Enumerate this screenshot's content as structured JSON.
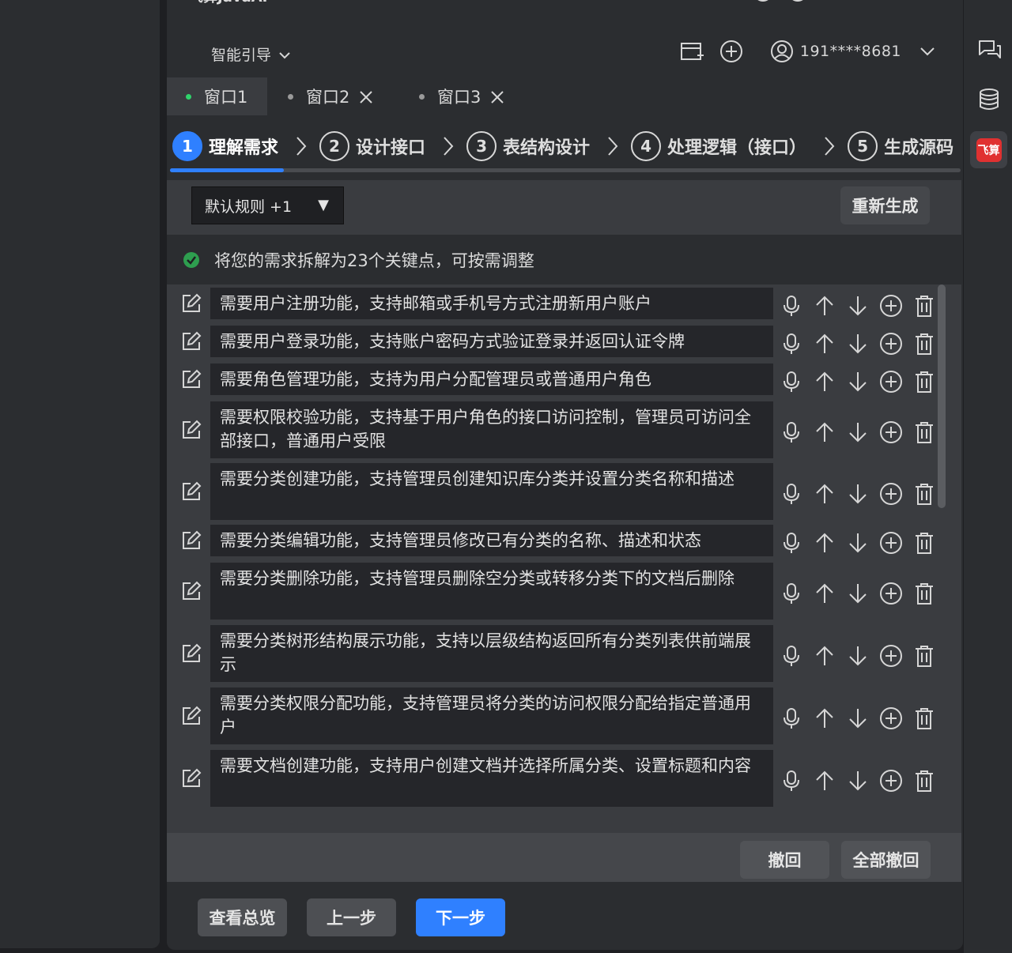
{
  "app": {
    "title": "飞算JavaAI",
    "smart_guide_label": "智能引导",
    "user_phone": "191****8681"
  },
  "tabs": [
    {
      "label": "窗口1",
      "active": true
    },
    {
      "label": "窗口2",
      "active": false
    },
    {
      "label": "窗口3",
      "active": false
    }
  ],
  "steps": [
    {
      "num": "1",
      "label": "理解需求",
      "active": true
    },
    {
      "num": "2",
      "label": "设计接口",
      "active": false
    },
    {
      "num": "3",
      "label": "表结构设计",
      "active": false
    },
    {
      "num": "4",
      "label": "处理逻辑（接口）",
      "active": false
    },
    {
      "num": "5",
      "label": "生成源码",
      "active": false
    }
  ],
  "toolbar": {
    "rule_select_value": "默认规则 +1",
    "regenerate_label": "重新生成"
  },
  "info": {
    "message": "将您的需求拆解为23个关键点，可按需调整"
  },
  "requirements": [
    "需要用户注册功能，支持邮箱或手机号方式注册新用户账户",
    "需要用户登录功能，支持账户密码方式验证登录并返回认证令牌",
    "需要角色管理功能，支持为用户分配管理员或普通用户角色",
    "需要权限校验功能，支持基于用户角色的接口访问控制，管理员可访问全部接口，普通用户受限",
    "需要分类创建功能，支持管理员创建知识库分类并设置分类名称和描述",
    "需要分类编辑功能，支持管理员修改已有分类的名称、描述和状态",
    "需要分类删除功能，支持管理员删除空分类或转移分类下的文档后删除",
    "需要分类树形结构展示功能，支持以层级结构返回所有分类列表供前端展示",
    "需要分类权限分配功能，支持管理员将分类的访问权限分配给指定普通用户",
    "需要文档创建功能，支持用户创建文档并选择所属分类、设置标题和内容"
  ],
  "bottom_actions": {
    "revoke_label": "撤回",
    "revoke_all_label": "全部撤回"
  },
  "footer": {
    "overview_label": "查看总览",
    "prev_label": "上一步",
    "next_label": "下一步"
  },
  "rail": {
    "brand_label": "飞算"
  },
  "colors": {
    "accent": "#2f80ff",
    "success": "#2fd36b",
    "brand": "#e03131"
  }
}
